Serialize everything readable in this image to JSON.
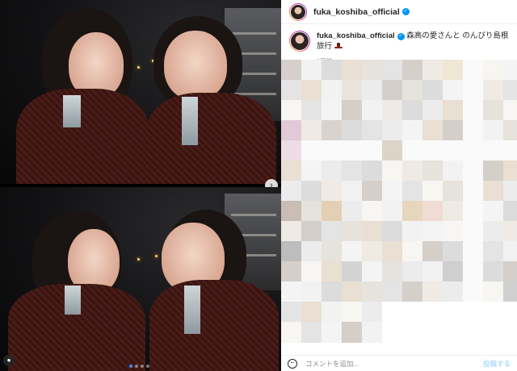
{
  "post": {
    "username": "fuka_koshiba_official",
    "verified": true,
    "caption_text": "森高の愛さんと のんびり島根旅行",
    "caption_emoji_icon": "hat-icon",
    "time_ago": "1日前"
  },
  "media": {
    "carousel_dots": 4,
    "active_dot": 0,
    "next_icon": "chevron-right-icon",
    "tag_icon": "user-tag-icon"
  },
  "comment_box": {
    "placeholder": "コメントを追加...",
    "post_label": "投稿する",
    "emoji_icon": "emoji-icon"
  },
  "colors": {
    "verified": "#0095f6",
    "post_button_disabled": "#b2dffc",
    "active_dot": "#3a8bff"
  }
}
